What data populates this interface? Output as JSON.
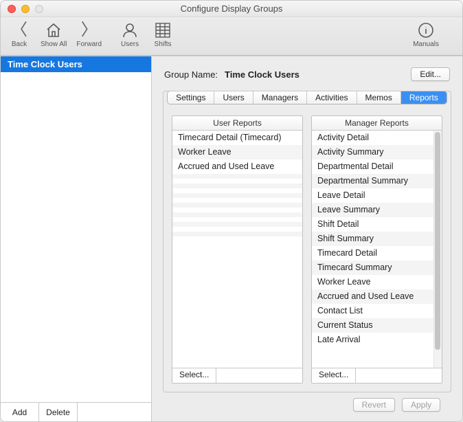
{
  "window": {
    "title": "Configure Display Groups"
  },
  "toolbar": {
    "back_label": "Back",
    "showall_label": "Show All",
    "forward_label": "Forward",
    "users_label": "Users",
    "shifts_label": "Shifts",
    "manuals_label": "Manuals"
  },
  "sidebar": {
    "items": [
      {
        "label": "Time Clock Users",
        "selected": true
      }
    ],
    "add_label": "Add",
    "delete_label": "Delete"
  },
  "group": {
    "name_label": "Group Name:",
    "name_value": "Time Clock Users",
    "edit_label": "Edit..."
  },
  "tabs": {
    "items": [
      "Settings",
      "Users",
      "Managers",
      "Activities",
      "Memos",
      "Reports"
    ],
    "active_index": 5
  },
  "reports": {
    "user_header": "User Reports",
    "manager_header": "Manager Reports",
    "select_label": "Select...",
    "user_reports": [
      "Timecard Detail (Timecard)",
      "Worker Leave",
      "Accrued and Used Leave"
    ],
    "manager_reports": [
      "Activity Detail",
      "Activity Summary",
      "Departmental Detail",
      "Departmental Summary",
      "Leave Detail",
      "Leave Summary",
      "Shift Detail",
      "Shift Summary",
      "Timecard Detail",
      "Timecard Summary",
      "Worker Leave",
      "Accrued and Used Leave",
      "Contact List",
      "Current Status",
      "Late Arrival"
    ]
  },
  "footer": {
    "revert_label": "Revert",
    "apply_label": "Apply"
  }
}
